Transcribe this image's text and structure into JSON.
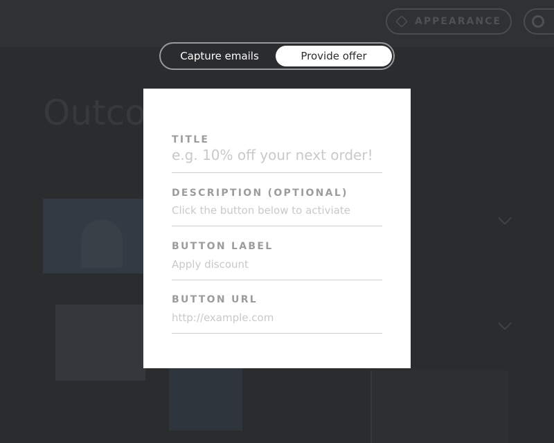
{
  "mode_toggle": {
    "options": [
      {
        "label": "Capture emails",
        "selected": false
      },
      {
        "label": "Provide offer",
        "selected": true
      }
    ]
  },
  "offer_form": {
    "fields": [
      {
        "label": "TITLE",
        "placeholder": "e.g. 10% off your next order!"
      },
      {
        "label": "DESCRIPTION (OPTIONAL)",
        "placeholder": "Click the button below to activiate"
      },
      {
        "label": "BUTTON LABEL",
        "placeholder": "Apply discount"
      },
      {
        "label": "BUTTON URL",
        "placeholder": "http://example.com"
      }
    ]
  },
  "background": {
    "appearance_button_label": "APPEARANCE",
    "heading": "Outco"
  },
  "colors": {
    "overlay_background": "#2b2c2e",
    "modal_background": "#ffffff",
    "label_text": "#9c9c9e",
    "placeholder_text": "#c9c9cb",
    "toggle_border": "#9a9b9d"
  }
}
